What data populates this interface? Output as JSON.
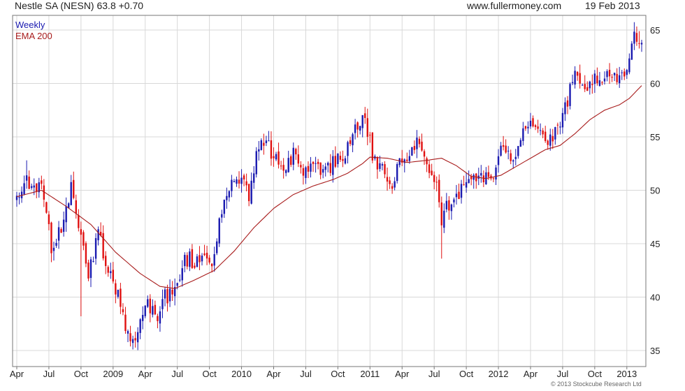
{
  "header": {
    "title": "Nestle SA (NESN) 63.8 +0.70",
    "site": "www.fullermoney.com",
    "date": "19 Feb 2013"
  },
  "legend": {
    "weekly": "Weekly",
    "ema": "EMA 200"
  },
  "copyright": "© 2013 Stockcube Research Ltd",
  "colors": {
    "up": "#1a1ab0",
    "down": "#e01010",
    "ema": "#a81c1c",
    "grid": "#d8d8d8"
  },
  "chart_data": {
    "type": "candlestick",
    "interval": "weekly",
    "ylim": [
      34,
      66
    ],
    "yticks": [
      35,
      40,
      45,
      50,
      55,
      60,
      65
    ],
    "grid": true,
    "xticks": [
      {
        "label": "Apr",
        "week": 0
      },
      {
        "label": "Jul",
        "week": 13
      },
      {
        "label": "Oct",
        "week": 26
      },
      {
        "label": "2009",
        "week": 39
      },
      {
        "label": "Apr",
        "week": 52
      },
      {
        "label": "Jul",
        "week": 65
      },
      {
        "label": "Oct",
        "week": 78
      },
      {
        "label": "2010",
        "week": 91
      },
      {
        "label": "Apr",
        "week": 104
      },
      {
        "label": "Jul",
        "week": 117
      },
      {
        "label": "Oct",
        "week": 130
      },
      {
        "label": "2011",
        "week": 143
      },
      {
        "label": "Apr",
        "week": 156
      },
      {
        "label": "Jul",
        "week": 169
      },
      {
        "label": "Oct",
        "week": 182
      },
      {
        "label": "2012",
        "week": 195
      },
      {
        "label": "Apr",
        "week": 208
      },
      {
        "label": "Jul",
        "week": 221
      },
      {
        "label": "Oct",
        "week": 234
      },
      {
        "label": "2013",
        "week": 247
      }
    ],
    "week_count": 254,
    "close_path": [
      [
        0,
        49.5
      ],
      [
        4,
        51.5
      ],
      [
        6,
        50.0
      ],
      [
        10,
        50.8
      ],
      [
        14,
        44.5
      ],
      [
        18,
        46.5
      ],
      [
        22,
        50.0
      ],
      [
        26,
        46.0
      ],
      [
        29,
        41.5
      ],
      [
        33,
        46.5
      ],
      [
        36,
        42.5
      ],
      [
        40,
        41.0
      ],
      [
        44,
        37.5
      ],
      [
        47,
        35.8
      ],
      [
        50,
        37.5
      ],
      [
        53,
        39.5
      ],
      [
        57,
        38.5
      ],
      [
        60,
        40.0
      ],
      [
        64,
        40.5
      ],
      [
        68,
        43.5
      ],
      [
        72,
        43.5
      ],
      [
        76,
        44.5
      ],
      [
        79,
        43.5
      ],
      [
        83,
        48.5
      ],
      [
        87,
        50.5
      ],
      [
        91,
        51.0
      ],
      [
        94,
        49.5
      ],
      [
        97,
        53.0
      ],
      [
        100,
        54.5
      ],
      [
        104,
        53.5
      ],
      [
        108,
        51.5
      ],
      [
        112,
        53.5
      ],
      [
        116,
        51.5
      ],
      [
        120,
        52.5
      ],
      [
        124,
        52.0
      ],
      [
        128,
        52.5
      ],
      [
        132,
        53.0
      ],
      [
        136,
        55.0
      ],
      [
        140,
        56.5
      ],
      [
        142,
        55.5
      ],
      [
        145,
        52.5
      ],
      [
        149,
        52.0
      ],
      [
        152,
        50.5
      ],
      [
        155,
        52.5
      ],
      [
        159,
        53.5
      ],
      [
        163,
        54.5
      ],
      [
        166,
        52.5
      ],
      [
        170,
        51.0
      ],
      [
        172,
        47.0
      ],
      [
        174,
        49.0
      ],
      [
        177,
        48.5
      ],
      [
        180,
        50.0
      ],
      [
        183,
        51.0
      ],
      [
        187,
        51.5
      ],
      [
        191,
        51.0
      ],
      [
        194,
        51.5
      ],
      [
        197,
        54.5
      ],
      [
        201,
        53.0
      ],
      [
        205,
        56.0
      ],
      [
        209,
        56.5
      ],
      [
        213,
        55.0
      ],
      [
        216,
        54.5
      ],
      [
        219,
        55.5
      ],
      [
        223,
        58.5
      ],
      [
        226,
        60.5
      ],
      [
        230,
        59.0
      ],
      [
        233,
        60.5
      ],
      [
        236,
        59.5
      ],
      [
        240,
        61.0
      ],
      [
        244,
        60.0
      ],
      [
        247,
        61.5
      ],
      [
        249,
        64.0
      ],
      [
        251,
        64.5
      ],
      [
        253,
        63.8
      ]
    ],
    "ema_path": [
      [
        0,
        49.4
      ],
      [
        10,
        50.0
      ],
      [
        20,
        48.5
      ],
      [
        30,
        46.8
      ],
      [
        40,
        44.2
      ],
      [
        50,
        42.2
      ],
      [
        58,
        41.0
      ],
      [
        64,
        40.8
      ],
      [
        72,
        41.6
      ],
      [
        80,
        42.5
      ],
      [
        88,
        44.3
      ],
      [
        96,
        46.5
      ],
      [
        104,
        48.3
      ],
      [
        112,
        49.6
      ],
      [
        120,
        50.4
      ],
      [
        128,
        51.0
      ],
      [
        134,
        51.6
      ],
      [
        140,
        52.5
      ],
      [
        143,
        53.1
      ],
      [
        150,
        53.0
      ],
      [
        158,
        52.6
      ],
      [
        166,
        52.8
      ],
      [
        172,
        53.0
      ],
      [
        178,
        52.3
      ],
      [
        184,
        51.3
      ],
      [
        190,
        51.1
      ],
      [
        196,
        51.4
      ],
      [
        202,
        52.2
      ],
      [
        208,
        53.0
      ],
      [
        214,
        53.8
      ],
      [
        220,
        54.2
      ],
      [
        226,
        55.3
      ],
      [
        232,
        56.6
      ],
      [
        238,
        57.5
      ],
      [
        244,
        58.0
      ],
      [
        248,
        58.6
      ],
      [
        253,
        59.8
      ]
    ],
    "notable_lows": [
      {
        "week": 26,
        "low": 38.2
      },
      {
        "week": 47,
        "low": 35.1
      },
      {
        "week": 172,
        "low": 43.6
      }
    ],
    "notable_highs": [
      {
        "week": 4,
        "high": 52.8
      },
      {
        "week": 140,
        "high": 57.0
      },
      {
        "week": 252,
        "high": 64.9
      }
    ]
  }
}
